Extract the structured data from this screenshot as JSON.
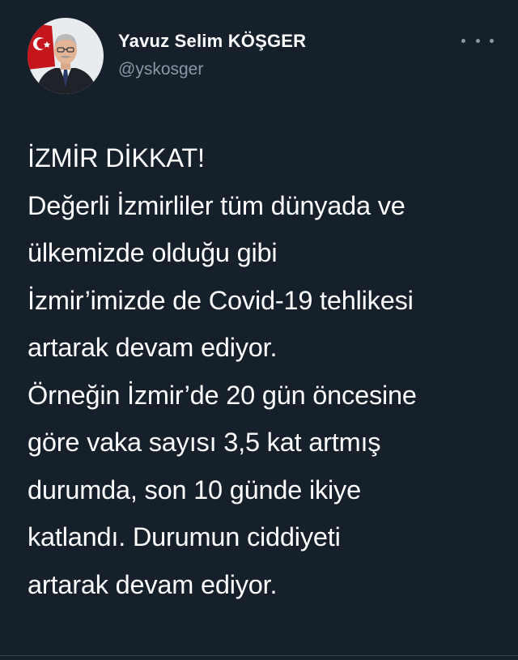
{
  "author": {
    "display_name": "Yavuz Selim KÖŞGER",
    "handle": "@yskosger",
    "avatar_icon": "person-portrait-avatar"
  },
  "menu": {
    "icon": "more-horizontal-icon"
  },
  "tweet": {
    "lines": [
      "İZMİR DİKKAT!",
      "Değerli İzmirliler tüm dünyada ve",
      "ülkemizde olduğu gibi",
      "İzmir’imizde de Covid-19 tehlikesi",
      "artarak devam ediyor.",
      "Örneğin İzmir’de 20 gün öncesine",
      "göre vaka sayısı 3,5 kat artmış",
      "durumda, son 10 günde ikiye",
      "katlandı. Durumun ciddiyeti",
      "artarak devam ediyor."
    ]
  },
  "colors": {
    "background": "#15202b",
    "primary_text": "#ffffff",
    "secondary_text": "#8899a6"
  }
}
